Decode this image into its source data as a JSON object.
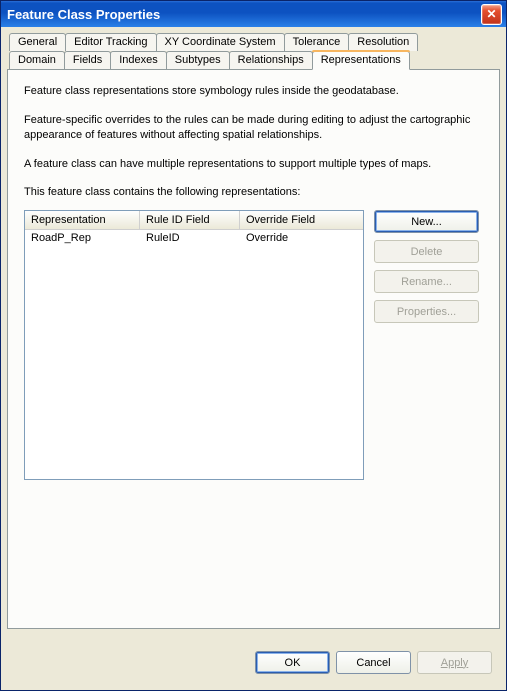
{
  "window": {
    "title": "Feature Class Properties"
  },
  "tabs_row1": [
    {
      "label": "General"
    },
    {
      "label": "Editor Tracking"
    },
    {
      "label": "XY Coordinate System"
    },
    {
      "label": "Tolerance"
    },
    {
      "label": "Resolution"
    }
  ],
  "tabs_row2": [
    {
      "label": "Domain"
    },
    {
      "label": "Fields"
    },
    {
      "label": "Indexes"
    },
    {
      "label": "Subtypes"
    },
    {
      "label": "Relationships"
    },
    {
      "label": "Representations",
      "active": true
    }
  ],
  "body": {
    "para1": "Feature class representations store symbology rules inside the geodatabase.",
    "para2": "Feature-specific overrides to the rules can be made during editing to adjust the cartographic appearance of features without affecting spatial relationships.",
    "para3": "A feature class can have multiple representations to support multiple types of maps.",
    "para4": "This feature class contains the following representations:"
  },
  "list": {
    "columns": [
      "Representation",
      "Rule ID Field",
      "Override Field"
    ],
    "rows": [
      {
        "rep": "RoadP_Rep",
        "rule": "RuleID",
        "ovr": "Override"
      }
    ]
  },
  "side_buttons": {
    "new": "New...",
    "delete": "Delete",
    "rename": "Rename...",
    "properties": "Properties..."
  },
  "footer": {
    "ok": "OK",
    "cancel": "Cancel",
    "apply": "Apply"
  }
}
